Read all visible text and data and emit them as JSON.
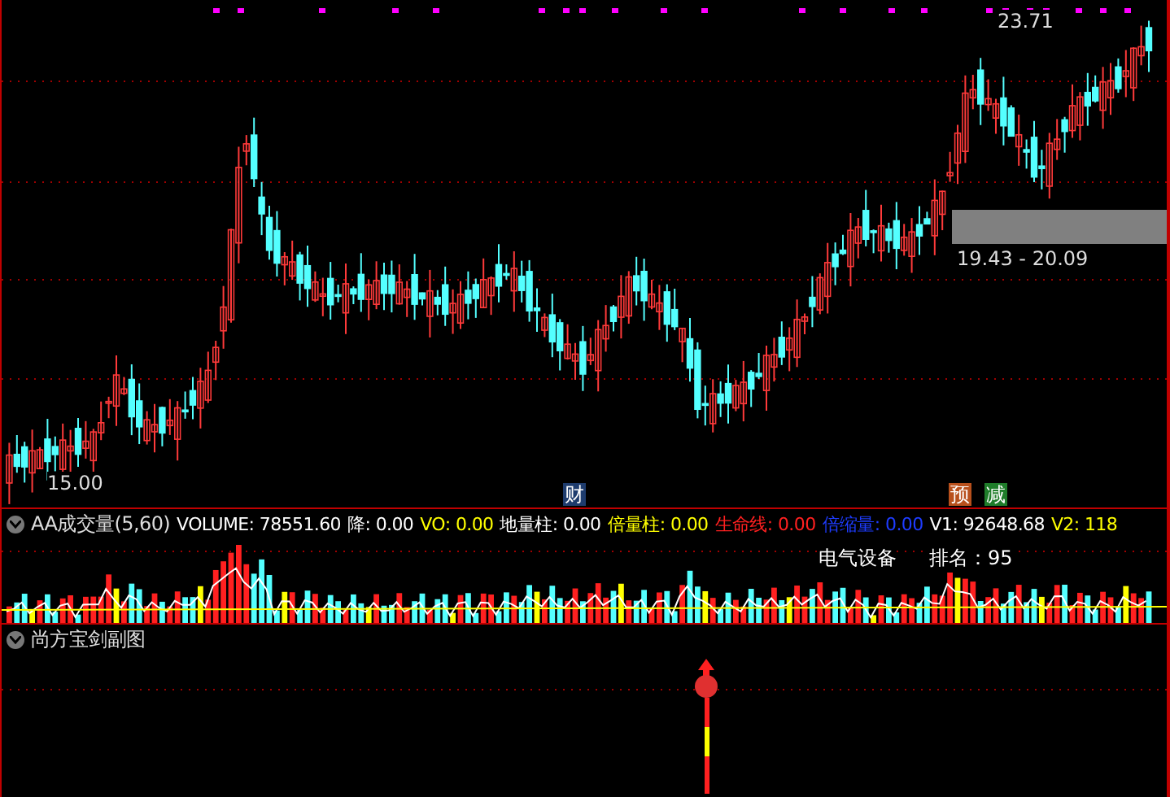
{
  "price_panel": {
    "high_label": "23.71",
    "low_label": "15.00",
    "zone_label": "19.43 - 20.09",
    "badges": [
      {
        "text": "财",
        "color": "#1e3c6e"
      },
      {
        "text": "预",
        "color": "#b8501c"
      },
      {
        "text": "减",
        "color": "#1f7d2a"
      }
    ]
  },
  "volume_panel": {
    "title": "AA成交量(5,60)",
    "readings": [
      {
        "label": "VOLUME:",
        "value": "78551.60",
        "color": "#ffffff"
      },
      {
        "label": "降:",
        "value": "0.00",
        "color": "#ffffff"
      },
      {
        "label": "VO:",
        "value": "0.00",
        "color": "#ffff00"
      },
      {
        "label": "地量柱:",
        "value": "0.00",
        "color": "#ffffff"
      },
      {
        "label": "倍量柱:",
        "value": "0.00",
        "color": "#ffff00"
      },
      {
        "label": "生命线:",
        "value": "0.00",
        "color": "#ff2020"
      },
      {
        "label": "倍缩量:",
        "value": "0.00",
        "color": "#1e3cff"
      },
      {
        "label": "V1:",
        "value": "92648.68",
        "color": "#ffffff"
      },
      {
        "label": "V2:",
        "value": "118",
        "color": "#ffff00"
      }
    ],
    "sector": "电气设备",
    "rank": "排名：95"
  },
  "sub_panel": {
    "title": "尚方宝剑副图"
  }
}
